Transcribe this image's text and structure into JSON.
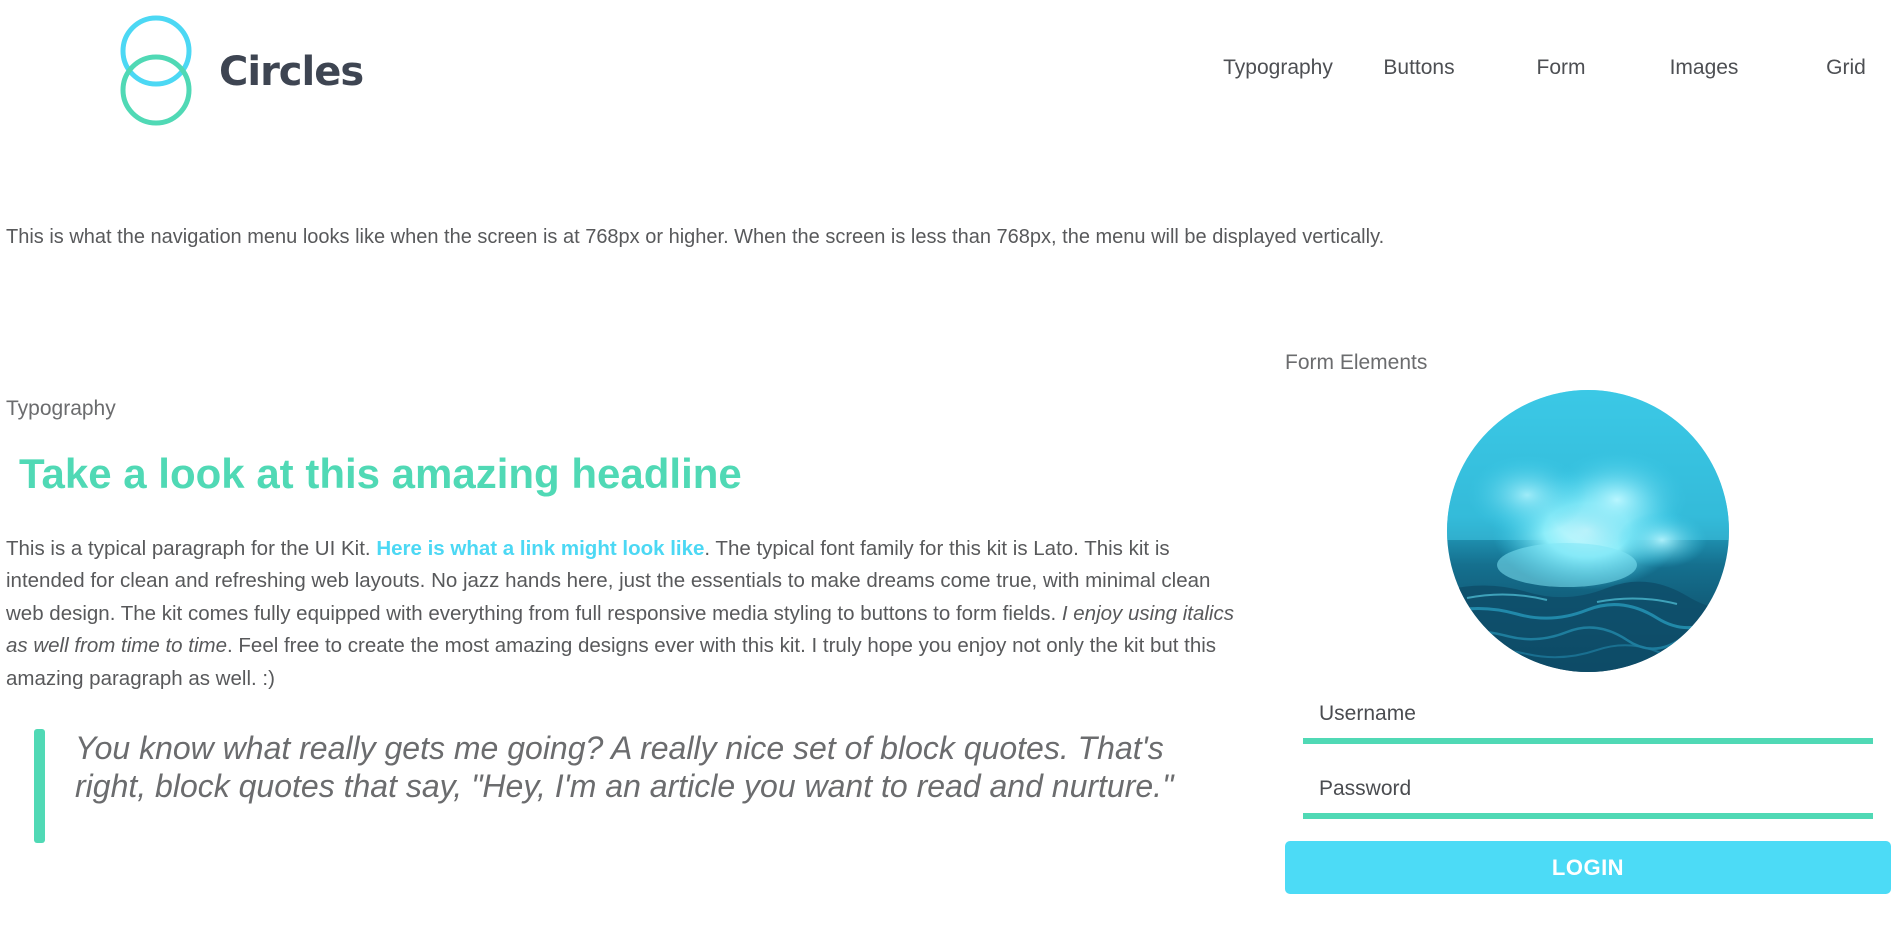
{
  "brand": {
    "logo_icon": "two-overlapping-circles-icon",
    "name": "Circles",
    "colors": {
      "circle_top": "#4cd8f4",
      "circle_bottom": "#50d9b5",
      "text": "#3e4552"
    }
  },
  "nav": {
    "items": [
      {
        "label": "Typography"
      },
      {
        "label": "Buttons"
      },
      {
        "label": "Form"
      },
      {
        "label": "Images"
      },
      {
        "label": "Grid"
      }
    ]
  },
  "nav_note": "This is what the navigation menu looks like when the screen is at 768px or higher. When the screen is less than 768px, the menu will be displayed vertically.",
  "typography": {
    "label": "Typography",
    "headline": "Take a look at this amazing headline",
    "paragraph": {
      "part1": "This is a typical paragraph for the UI Kit. ",
      "link": "Here is what a link might look like",
      "part2": ". The typical font family for this kit is Lato. This kit is intended for clean and refreshing web layouts. No jazz hands here, just the essentials to make dreams come true, with minimal clean web design. The kit comes fully equipped with everything from full responsive media styling to buttons to form fields. ",
      "italic": "I enjoy using italics as well from time to time",
      "part3": ". Feel free to create the most amazing designs ever with this kit. I truly hope you enjoy not only the kit but this amazing paragraph as well. :)"
    },
    "blockquote": "You know what really gets me going? A really nice set of block quotes. That's right, block quotes that say, \"Hey, I'm an article you want to read and nurture.\""
  },
  "form": {
    "label": "Form Elements",
    "image": "ocean-wave-photo",
    "username": {
      "placeholder": "Username",
      "value": ""
    },
    "password": {
      "placeholder": "Password",
      "value": ""
    },
    "login_label": "LOGIN"
  },
  "colors": {
    "accent_green": "#50d9b5",
    "accent_blue": "#4cd8f4",
    "text_gray": "#58595b"
  }
}
